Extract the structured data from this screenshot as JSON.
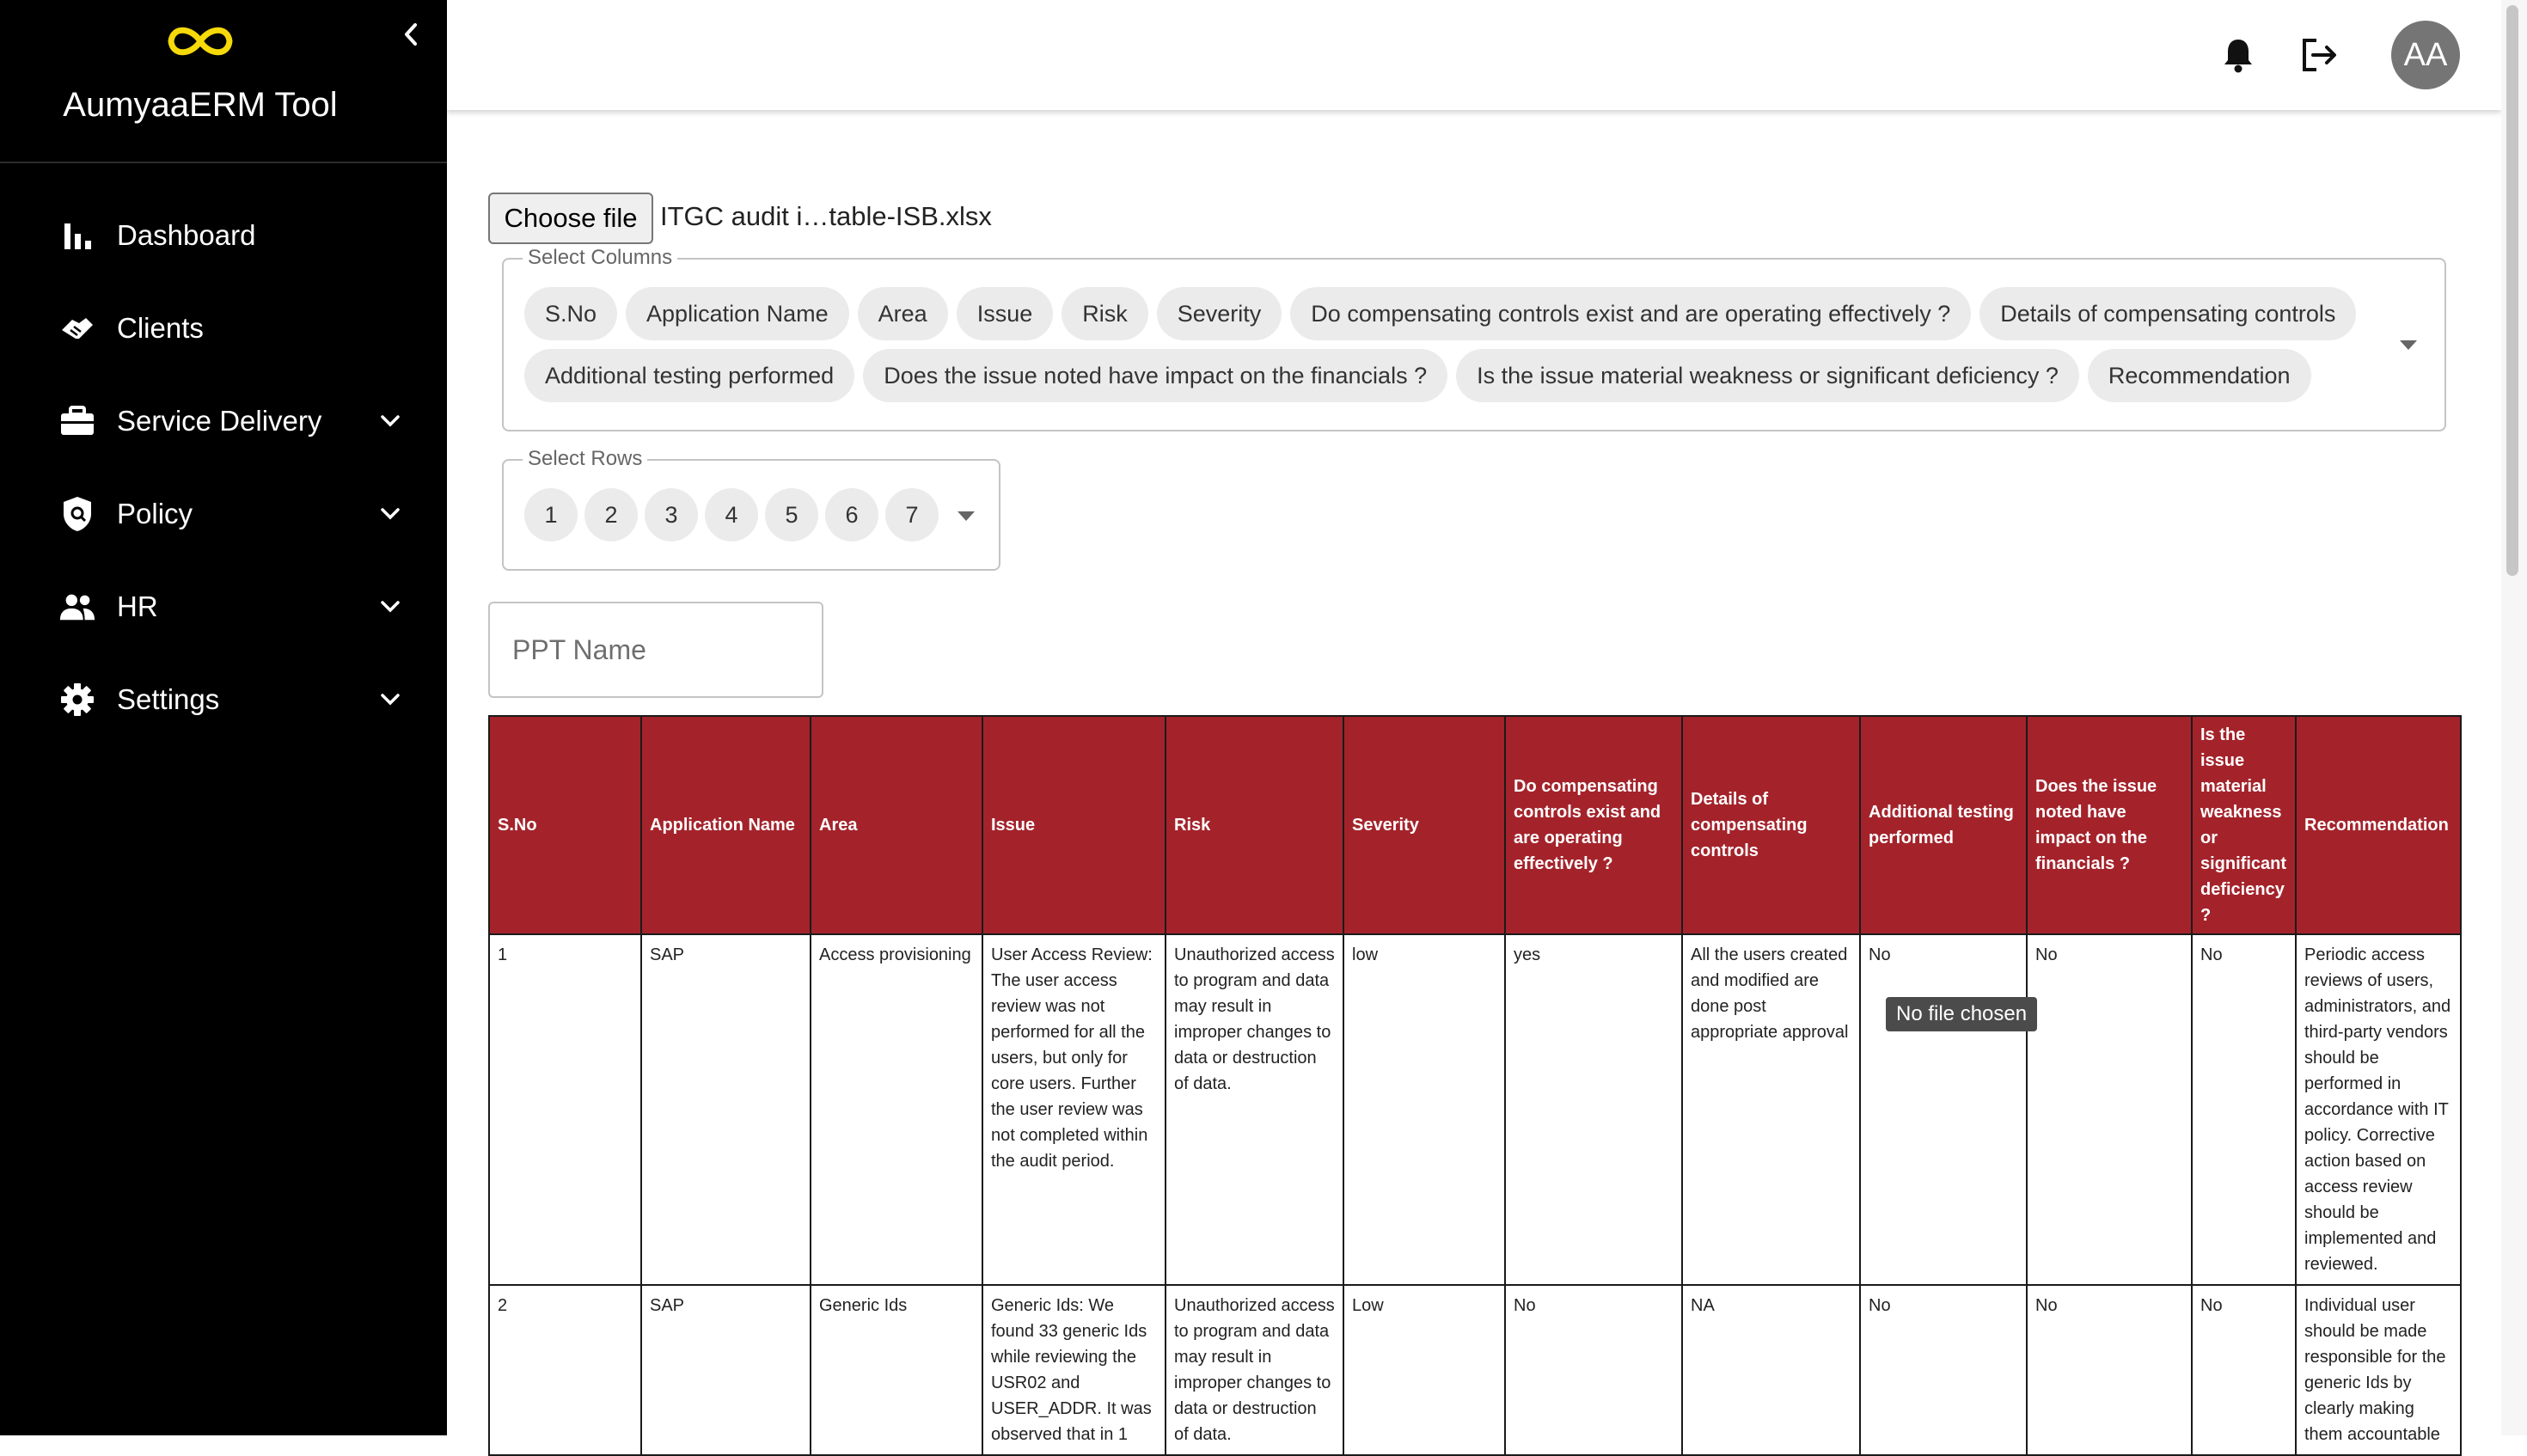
{
  "app": {
    "title": "AumyaaERM Tool",
    "logo_icon": "infinity-logo",
    "logo_color": "#f5d90a"
  },
  "sidebar": {
    "items": [
      {
        "label": "Dashboard",
        "icon": "bar-chart-icon",
        "expandable": false
      },
      {
        "label": "Clients",
        "icon": "handshake-icon",
        "expandable": false
      },
      {
        "label": "Service Delivery",
        "icon": "briefcase-icon",
        "expandable": true
      },
      {
        "label": "Policy",
        "icon": "shield-icon",
        "expandable": true
      },
      {
        "label": "HR",
        "icon": "people-icon",
        "expandable": true
      },
      {
        "label": "Settings",
        "icon": "gear-icon",
        "expandable": true
      }
    ]
  },
  "header": {
    "avatar_initials": "AA",
    "icons": [
      "bell-icon",
      "logout-icon"
    ]
  },
  "file": {
    "button_label": "Choose file",
    "file_name": "ITGC audit i…table-ISB.xlsx",
    "tooltip": "No file chosen"
  },
  "select_columns": {
    "label": "Select Columns",
    "chips": [
      "S.No",
      "Application Name",
      "Area",
      "Issue",
      "Risk",
      "Severity",
      "Do compensating controls exist and are operating effectively ?",
      "Details of compensating controls",
      "Additional testing performed",
      "Does the issue noted have impact on the financials ?",
      "Is the issue material weakness or significant deficiency ?",
      "Recommendation"
    ]
  },
  "select_rows": {
    "label": "Select Rows",
    "chips": [
      "1",
      "2",
      "3",
      "4",
      "5",
      "6",
      "7"
    ]
  },
  "ppt": {
    "placeholder": "PPT Name"
  },
  "table": {
    "header_color": "#a4232b",
    "columns": [
      "S.No",
      "Application Name",
      "Area",
      "Issue",
      "Risk",
      "Severity",
      "Do compensating controls exist and are operating effectively ?",
      "Details of compensating controls",
      "Additional testing performed",
      "Does the issue noted have impact on the financials ?",
      "Is the issue material weakness or significant deficiency ?",
      "Recommendation"
    ],
    "rows": [
      [
        "1",
        "SAP",
        "Access provisioning",
        "User Access Review: The user access review was not performed for all the users, but only for core users. Further the user review was not completed within the audit period.",
        "Unauthorized access to program and data may result in improper changes to data or destruction of data.",
        "low",
        "yes",
        "All the users created and modified are done post appropriate approval",
        "No",
        "No",
        "No",
        "Periodic access reviews of users, administrators, and third-party vendors should be performed in accordance with IT policy. Corrective action based on access review should be implemented and reviewed."
      ],
      [
        "2",
        "SAP",
        "Generic Ids",
        "Generic Ids: We found 33 generic Ids while reviewing the USR02 and USER_ADDR. It was observed that in 1",
        "Unauthorized access to program and data may result in improper changes to data or destruction of data.",
        "Low",
        "No",
        "NA",
        "No",
        "No",
        "No",
        "Individual user should be made responsible for the generic Ids by clearly making them accountable"
      ]
    ]
  }
}
